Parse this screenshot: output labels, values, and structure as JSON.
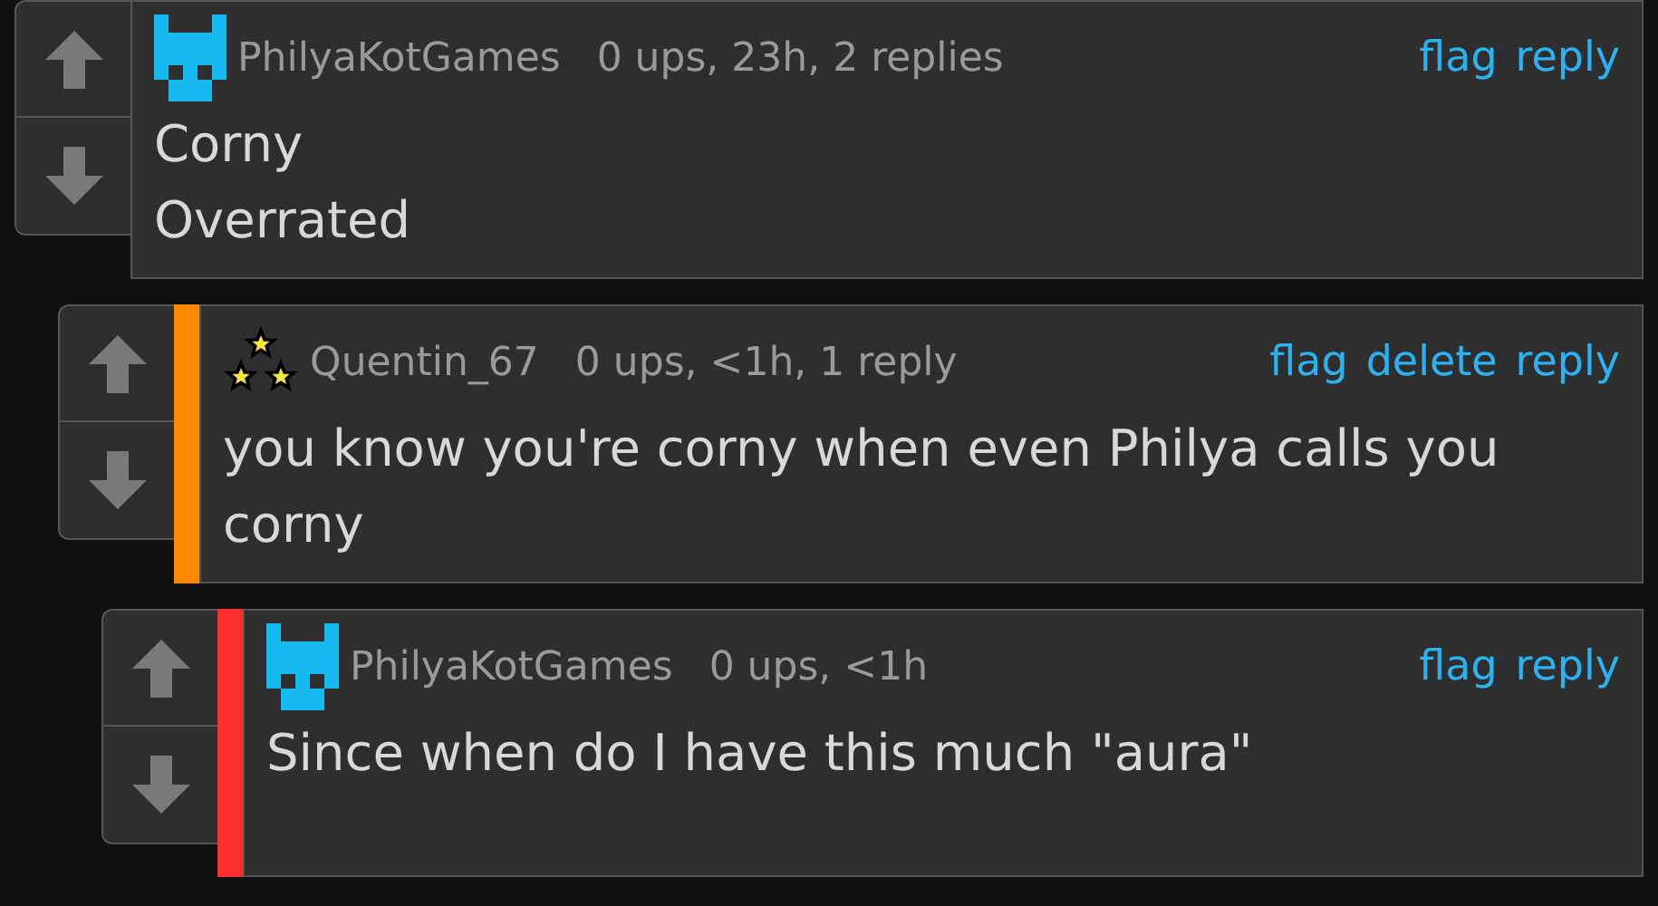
{
  "comments": [
    {
      "kind": "cat",
      "user": "PhilyaKotGames",
      "meta": "0 ups, 23h, 2 replies",
      "actions": [
        "flag",
        "reply"
      ],
      "text": "Corny\nOverrated",
      "children": [
        {
          "kind": "stars",
          "color": "#ff8a00",
          "user": "Quentin_67",
          "meta": "0 ups, <1h, 1 reply",
          "actions": [
            "flag",
            "delete",
            "reply"
          ],
          "text": "you know you're corny when even Philya calls you corny",
          "children": [
            {
              "kind": "cat",
              "color": "#ff3030",
              "user": "PhilyaKotGames",
              "meta": "0 ups, <1h",
              "actions": [
                "flag",
                "reply"
              ],
              "text": "Since when do I have this much \"aura\""
            }
          ]
        }
      ]
    }
  ]
}
